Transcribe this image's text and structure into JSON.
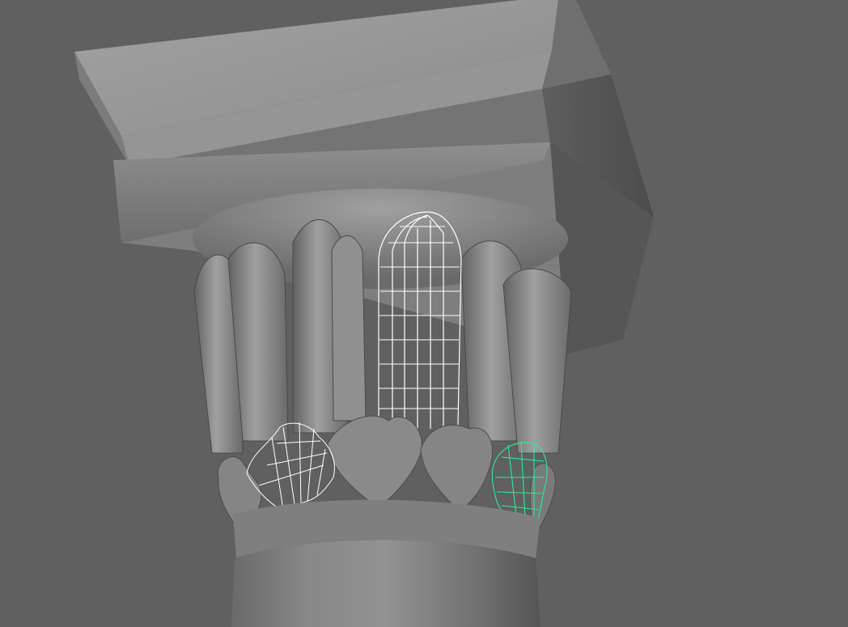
{
  "viewport": {
    "background_color": "#606060",
    "model_color": "#8a8a8a",
    "selected_color": "#2de89a",
    "wire_color": "#ffffff"
  },
  "scene": {
    "objects": [
      {
        "name": "abacus-block"
      },
      {
        "name": "echinus-dome"
      },
      {
        "name": "tall-leaf-row"
      },
      {
        "name": "wireframe-tall-leaf"
      },
      {
        "name": "acanthus-leaf-row"
      },
      {
        "name": "wireframe-acanthus-leaf"
      },
      {
        "name": "selected-acanthus-leaf"
      },
      {
        "name": "astragal-ring"
      },
      {
        "name": "column-shaft"
      }
    ]
  }
}
